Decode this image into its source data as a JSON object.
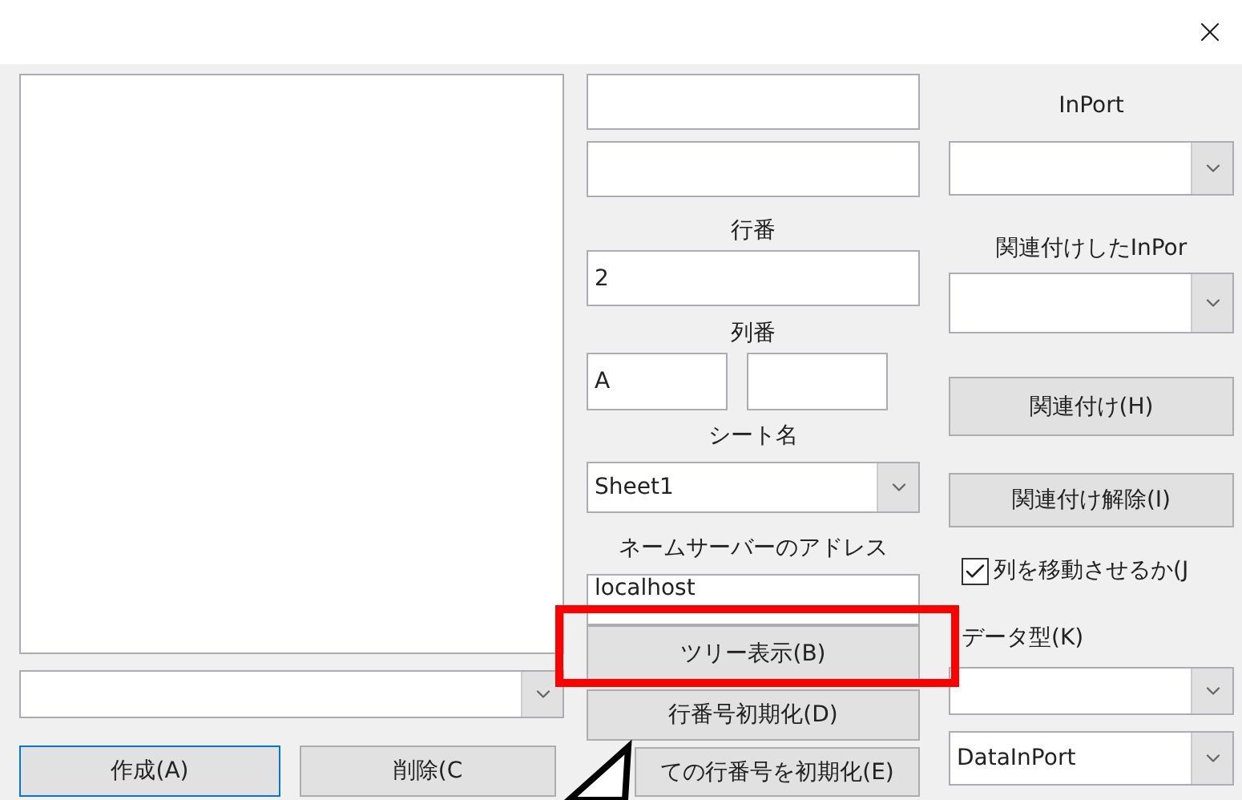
{
  "left": {
    "combo": {
      "kind": "combo"
    },
    "buttons": [
      {
        "label": "作成(A)",
        "focused": true
      },
      {
        "label": "削除(C",
        "focused": false
      }
    ]
  },
  "middle": [
    {
      "kind": "field"
    },
    {
      "kind": "field"
    },
    {
      "kind": "label",
      "text": "行番"
    },
    {
      "kind": "field",
      "value": "2"
    },
    {
      "kind": "label",
      "text": "列番"
    },
    {
      "kind": "pair",
      "value": "A"
    },
    {
      "kind": "label",
      "text": "シート名"
    },
    {
      "kind": "combo",
      "value": "Sheet1"
    },
    {
      "kind": "label",
      "text": "ネームサーバーのアドレス"
    },
    {
      "kind": "field",
      "value": "localhost"
    },
    {
      "kind": "button",
      "label": "ツリー表示(B)"
    },
    {
      "kind": "button",
      "label": "行番号初期化(D)"
    },
    {
      "kind": "button",
      "label": "ての行番号を初期化(E)"
    }
  ],
  "right": [
    {
      "kind": "label",
      "text": "InPort"
    },
    {
      "kind": "combo"
    },
    {
      "kind": "label",
      "text": "関連付けしたInPor"
    },
    {
      "kind": "combo"
    },
    {
      "kind": "button",
      "label": "関連付け(H)"
    },
    {
      "kind": "button",
      "label": "関連付け解除(I)"
    },
    {
      "kind": "check",
      "label": "列を移動させるか(J",
      "checked": true
    },
    {
      "kind": "caption",
      "text": "データ型(K)"
    },
    {
      "kind": "combo"
    },
    {
      "kind": "combo",
      "value": "DataInPort"
    }
  ]
}
